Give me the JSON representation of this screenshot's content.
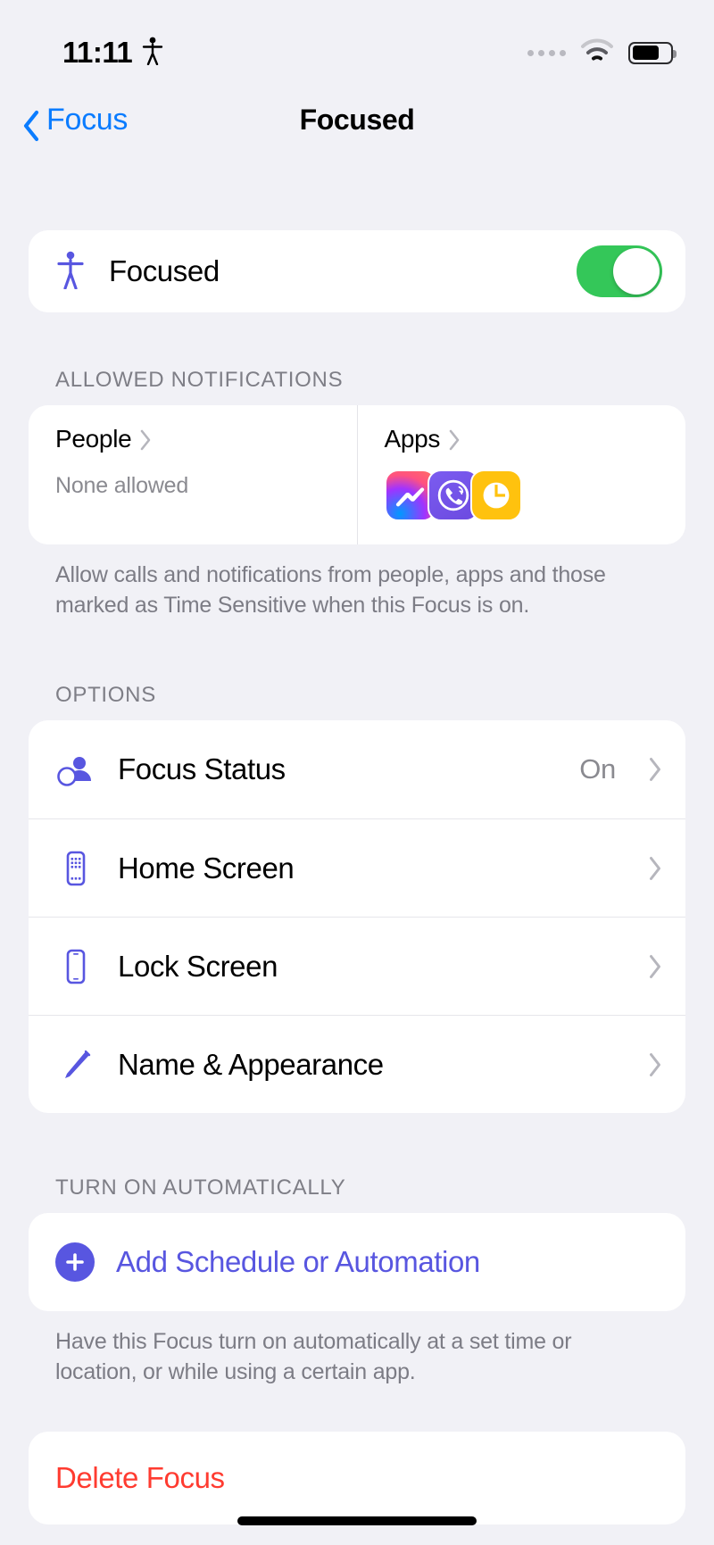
{
  "status_bar": {
    "time": "11:11",
    "focus_icon": "accessibility-person-icon",
    "signal_icon": "cellular-dots-icon",
    "wifi_icon": "wifi-icon",
    "battery_icon": "battery-icon",
    "battery_level": 72
  },
  "nav": {
    "back_label": "Focus",
    "back_icon": "chevron-left-icon",
    "title": "Focused"
  },
  "master": {
    "icon": "accessibility-person-icon",
    "label": "Focused",
    "toggle_on": true,
    "toggle_color": "#34c759"
  },
  "allowed_notifications": {
    "header": "ALLOWED NOTIFICATIONS",
    "people": {
      "label": "People",
      "chevron_icon": "chevron-right-icon",
      "value": "None allowed"
    },
    "apps": {
      "label": "Apps",
      "chevron_icon": "chevron-right-icon",
      "icons": [
        {
          "name": "messenger-app-icon",
          "label": "Messenger"
        },
        {
          "name": "viber-app-icon",
          "label": "Viber"
        },
        {
          "name": "clock-app-icon",
          "label": "Clock"
        }
      ]
    },
    "footnote": "Allow calls and notifications from people, apps and those marked as Time Sensitive when this Focus is on."
  },
  "options": {
    "header": "OPTIONS",
    "rows": [
      {
        "label": "Focus Status",
        "value": "On",
        "icon": "focus-status-person-moon-icon"
      },
      {
        "label": "Home Screen",
        "value": "",
        "icon": "home-screen-phone-grid-icon"
      },
      {
        "label": "Lock Screen",
        "value": "",
        "icon": "lock-screen-phone-icon"
      },
      {
        "label": "Name & Appearance",
        "value": "",
        "icon": "pencil-icon"
      }
    ]
  },
  "turn_on_automatically": {
    "header": "TURN ON AUTOMATICALLY",
    "add_label": "Add Schedule or Automation",
    "add_icon": "plus-circle-icon",
    "footnote": "Have this Focus turn on automatically at a set time or location, or while using a certain app."
  },
  "delete": {
    "label": "Delete Focus",
    "color": "#ff3b30"
  },
  "colors": {
    "accent_purple": "#5856e0",
    "link_blue": "#0a7cff",
    "toggle_green": "#34c759",
    "destructive_red": "#ff3b30",
    "background": "#f1f1f6",
    "card": "#ffffff"
  }
}
